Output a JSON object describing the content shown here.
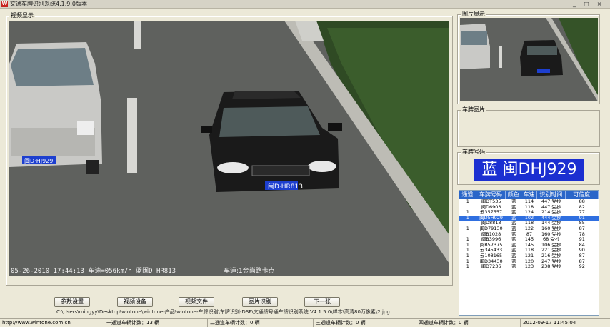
{
  "window": {
    "title": "文通车牌识别系统4.1.9.0版本",
    "icon": "app-logo-icon",
    "controls": [
      "minimize-icon",
      "maximize-icon",
      "close-icon"
    ],
    "control_glyphs": [
      "_",
      "□",
      "×"
    ]
  },
  "video_group": {
    "label": "视频显示",
    "overlay_left": "05-26-2010 17:44:13 车速=056km/h 蓝闽D HR813",
    "overlay_right": "车道:1金尚路卡点",
    "plate_on_car": "闽D·HR813",
    "plate_on_van": "闽D·HJ929"
  },
  "image_group": {
    "label": "图片显示"
  },
  "plate_image_group": {
    "label": "车牌图片"
  },
  "plate_number_group": {
    "label": "车牌号码",
    "value": "蓝 闽DHJ929"
  },
  "results": {
    "headers": [
      "通道",
      "车牌号码",
      "颜色",
      "车速",
      "识别时间",
      "可信度"
    ],
    "rows": [
      [
        "1",
        "闽DT535",
        "蓝",
        "114",
        "447",
        "受抄",
        "88"
      ],
      [
        "",
        "闽D6903",
        "蓝",
        "118",
        "447",
        "受抄",
        "82"
      ],
      [
        "1",
        "云357557",
        "蓝",
        "124",
        "214",
        "受抄",
        "77"
      ],
      [
        "1",
        "闽D5H929",
        "蓝",
        "102",
        "444",
        "受抄",
        "91"
      ],
      [
        "",
        "闽D8813",
        "蓝",
        "118",
        "144",
        "受抄",
        "85"
      ],
      [
        "1",
        "闽D79130",
        "蓝",
        "122",
        "160",
        "受抄",
        "87"
      ],
      [
        "",
        "闽B1028",
        "蓝",
        "87",
        "160",
        "受抄",
        "78"
      ],
      [
        "1",
        "闽B3996",
        "蓝",
        "145",
        "68",
        "受抄",
        "91"
      ],
      [
        "1",
        "闽B57375",
        "蓝",
        "145",
        "106",
        "受抄",
        "84"
      ],
      [
        "1",
        "云345433",
        "蓝",
        "118",
        "221",
        "受抄",
        "90"
      ],
      [
        "1",
        "云108165",
        "蓝",
        "121",
        "216",
        "受抄",
        "87"
      ],
      [
        "1",
        "闽D34430",
        "蓝",
        "120",
        "247",
        "受抄",
        "87"
      ],
      [
        "1",
        "闽D7236",
        "蓝",
        "123",
        "238",
        "受抄",
        "92"
      ]
    ],
    "selected_row": 3
  },
  "buttons": [
    "参数设置",
    "视频设备",
    "视频文件",
    "图片识别",
    "下一张"
  ],
  "file_path": "C:\\Users\\mingyy\\Desktop\\wintone\\wintone-产品\\wintone-车牌识别\\车牌识别-DSP\\文通牌号通车牌识别系统 V4.1.5.0\\样本\\高清80万像素\\2.jpg",
  "status_bar": {
    "website": "http://www.wintone.com.cn",
    "lane1": "一通道车辆计数：13 辆",
    "lane2": "二通道车辆计数：0 辆",
    "lane3": "三通道车辆计数：0 辆",
    "lane4": "四通道车辆计数：0 辆",
    "datetime": "2012-09-17 11:45:04"
  },
  "colors": {
    "plate_blue": "#1b2fd1",
    "header_blue": "#2a66c9",
    "selection_blue": "#2f6fe0",
    "window_bg": "#ece9d8"
  }
}
